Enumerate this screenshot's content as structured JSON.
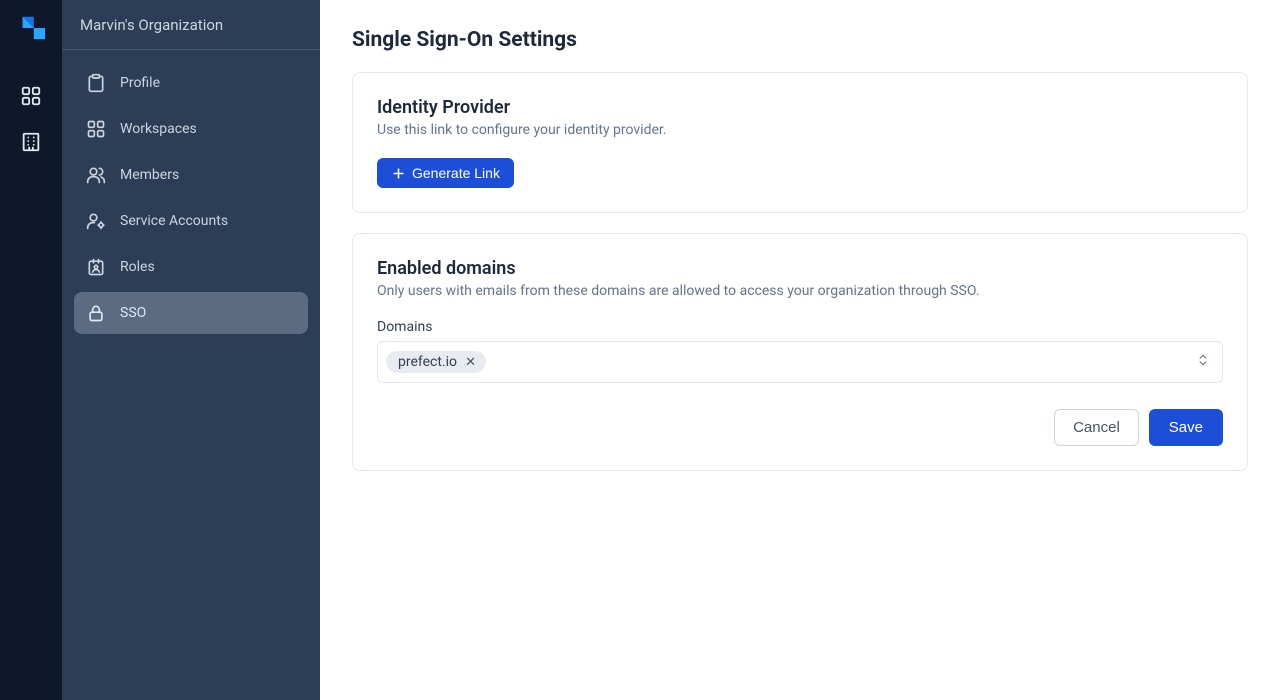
{
  "org_name": "Marvin's Organization",
  "sidebar": {
    "items": [
      {
        "label": "Profile"
      },
      {
        "label": "Workspaces"
      },
      {
        "label": "Members"
      },
      {
        "label": "Service Accounts"
      },
      {
        "label": "Roles"
      },
      {
        "label": "SSO"
      }
    ]
  },
  "page": {
    "title": "Single Sign-On Settings"
  },
  "idp_card": {
    "title": "Identity Provider",
    "subtitle": "Use this link to configure your identity provider.",
    "button_label": "Generate Link"
  },
  "domains_card": {
    "title": "Enabled domains",
    "subtitle": "Only users with emails from these domains are allowed to access your organization through SSO.",
    "field_label": "Domains",
    "tags": [
      "prefect.io"
    ],
    "cancel_label": "Cancel",
    "save_label": "Save"
  },
  "colors": {
    "primary": "#1d4ed8",
    "rail_bg": "#0f172a",
    "sidebar_bg": "#2c3e56"
  }
}
